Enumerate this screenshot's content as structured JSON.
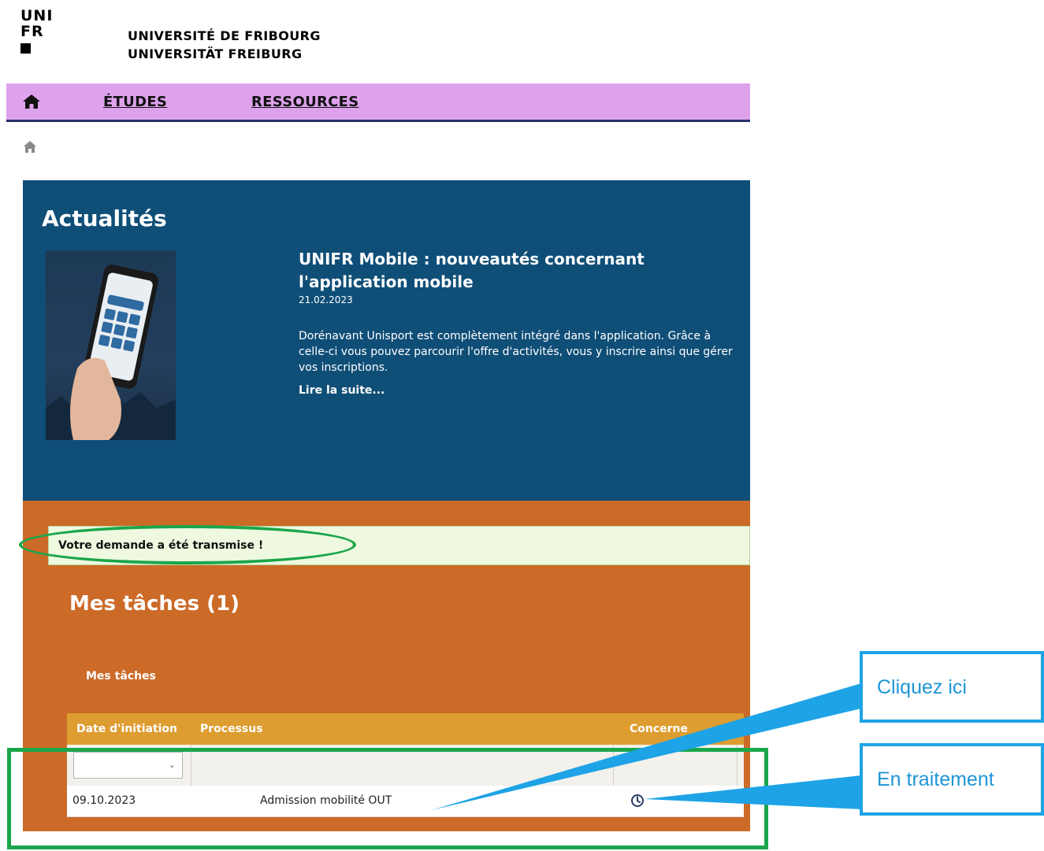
{
  "header": {
    "logo_lines": [
      "UNI",
      "FR"
    ],
    "university_fr": "UNIVERSITÉ DE FRIBOURG",
    "university_de": "UNIVERSITÄT FREIBURG"
  },
  "nav": {
    "home_icon": "home-icon",
    "items": [
      {
        "label": "ÉTUDES"
      },
      {
        "label": "RESSOURCES"
      }
    ],
    "background": "#dea2ed"
  },
  "breadcrumb": {
    "icon": "home-icon"
  },
  "news": {
    "heading": "Actualités",
    "background": "#0f4e77",
    "article": {
      "title": "UNIFR Mobile : nouveautés concernant l'application mobile",
      "date": "21.02.2023",
      "body": "Dorénavant Unisport est complètement intégré dans l'application. Grâce à celle-ci vous pouvez parcourir l'offre d'activités, vous y inscrire ainsi que gérer vos inscriptions.",
      "read_more": "Lire la suite..."
    }
  },
  "tasks": {
    "background": "#cc6a27",
    "alert": "Votre demande a été transmise !",
    "heading": "Mes tâches (1)",
    "tab": "Mes tâches",
    "table": {
      "columns": [
        "Date d'initiation",
        "Processus",
        "Concerne"
      ],
      "filter_select_value": "",
      "rows": [
        {
          "date": "09.10.2023",
          "process": "Admission mobilité OUT",
          "status_icon": "clock-icon"
        }
      ]
    }
  },
  "annotations": {
    "callout_click": "Cliquez ici",
    "callout_status": "En traitement",
    "highlight_color": "#1aa64b",
    "callout_color": "#1ea3e6"
  }
}
